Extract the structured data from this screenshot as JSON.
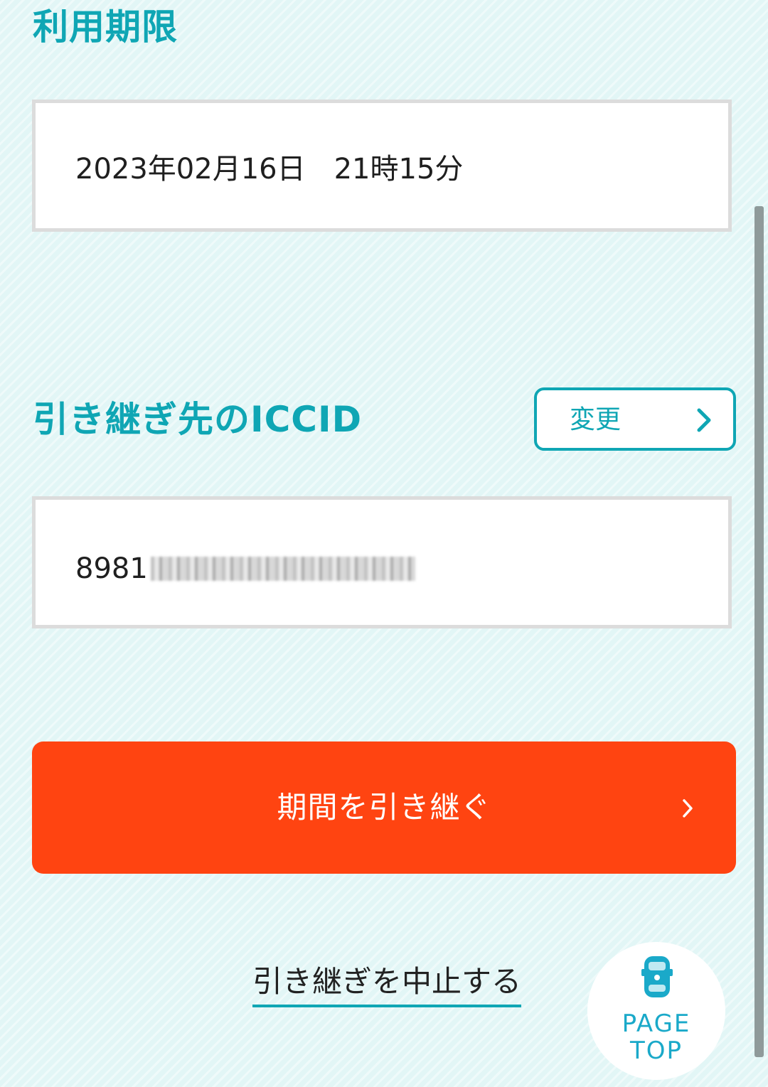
{
  "sections": {
    "expiry": {
      "title": "利用期限",
      "value": "2023年02月16日　21時15分"
    },
    "iccid": {
      "title": "引き継ぎ先のICCID",
      "change_button_label": "変更",
      "value_prefix": "8981"
    }
  },
  "actions": {
    "transfer_button_label": "期間を引き継ぐ",
    "cancel_link_label": "引き継ぎを中止する",
    "page_top_label_1": "PAGE",
    "page_top_label_2": "TOP"
  },
  "colors": {
    "accent": "#0fa6b4",
    "primary_button": "#ff4411",
    "background": "#e2f6f6"
  },
  "icons": {
    "change_chevron": "chevron-right-icon",
    "transfer_chevron": "chevron-right-icon",
    "page_top_mascot": "car-icon"
  }
}
